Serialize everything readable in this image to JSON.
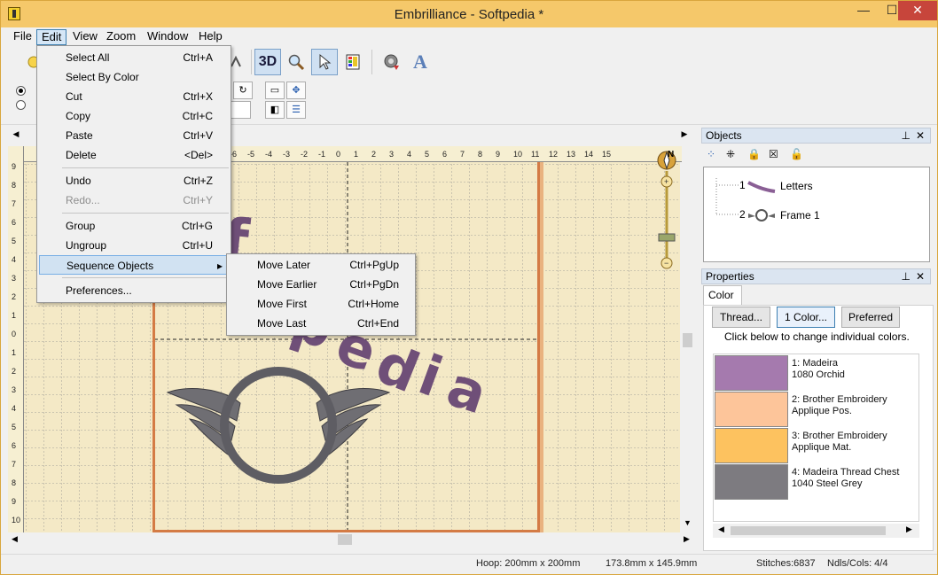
{
  "window": {
    "title": "Embrilliance - Softpedia *",
    "minimize": "—",
    "maximize": "☐",
    "close": "✕"
  },
  "menubar": [
    "File",
    "Edit",
    "View",
    "Zoom",
    "Window",
    "Help"
  ],
  "toolbar": {
    "btn_3d": "3D"
  },
  "edit_menu": {
    "items": [
      {
        "label": "Select All",
        "shortcut": "Ctrl+A"
      },
      {
        "label": "Select By Color",
        "shortcut": ""
      },
      {
        "label": "Cut",
        "shortcut": "Ctrl+X"
      },
      {
        "label": "Copy",
        "shortcut": "Ctrl+C"
      },
      {
        "label": "Paste",
        "shortcut": "Ctrl+V"
      },
      {
        "label": "Delete",
        "shortcut": "<Del>"
      },
      {
        "label": "Undo",
        "shortcut": "Ctrl+Z"
      },
      {
        "label": "Redo...",
        "shortcut": "Ctrl+Y"
      },
      {
        "label": "Group",
        "shortcut": "Ctrl+G"
      },
      {
        "label": "Ungroup",
        "shortcut": "Ctrl+U"
      },
      {
        "label": "Sequence Objects",
        "shortcut": "▸"
      },
      {
        "label": "Preferences...",
        "shortcut": ""
      }
    ]
  },
  "sequence_submenu": {
    "items": [
      {
        "label": "Move Later",
        "shortcut": "Ctrl+PgUp"
      },
      {
        "label": "Move Earlier",
        "shortcut": "Ctrl+PgDn"
      },
      {
        "label": "Move First",
        "shortcut": "Ctrl+Home"
      },
      {
        "label": "Move Last",
        "shortcut": "Ctrl+End"
      }
    ]
  },
  "ruler": {
    "top_ticks": [
      "-6",
      "-5",
      "-4",
      "-3",
      "-2",
      "-1",
      "0",
      "1",
      "2",
      "3",
      "4",
      "5",
      "6",
      "7",
      "8",
      "9",
      "10",
      "11",
      "12",
      "13",
      "14",
      "15"
    ],
    "left_ticks": [
      "9",
      "8",
      "7",
      "6",
      "5",
      "4",
      "3",
      "2",
      "1",
      "0",
      "1",
      "2",
      "3",
      "4",
      "5",
      "6",
      "7",
      "8",
      "9",
      "10"
    ]
  },
  "compass_label": "N",
  "objects_panel": {
    "title": "Objects",
    "items": [
      {
        "num": "1",
        "label": "Letters",
        "thumb": "letters-thumbnail"
      },
      {
        "num": "2",
        "label": "Frame 1",
        "thumb": "frame-thumbnail"
      }
    ]
  },
  "properties_panel": {
    "title": "Properties",
    "tab": "Color",
    "buttons": [
      "Thread...",
      "1 Color...",
      "Preferred"
    ],
    "hint": "Click below to change individual colors.",
    "colors": [
      {
        "label": "1: Madeira\n1080 Orchid",
        "hex": "#a57aae"
      },
      {
        "label": "2: Brother Embroidery\nApplique Pos.",
        "hex": "#fdc59a"
      },
      {
        "label": "3: Brother Embroidery\nApplique Mat.",
        "hex": "#fdc25f"
      },
      {
        "label": "4: Madeira Thread Chest\n1040 Steel Grey",
        "hex": "#7d7b80"
      }
    ]
  },
  "design_text": "Softpedia",
  "status": {
    "hoop": "Hoop: 200mm x 200mm",
    "size": "173.8mm x 145.9mm",
    "stitches": "Stitches:6837",
    "ndls": "Ndls/Cols: 4/4"
  }
}
